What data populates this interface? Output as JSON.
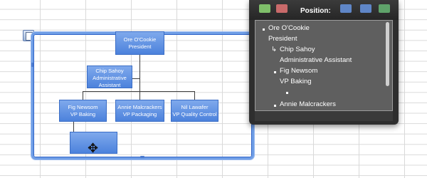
{
  "org_chart": {
    "nodes": {
      "president": {
        "name": "Ore O'Cookie",
        "title": "President"
      },
      "assistant": {
        "name": "Chip Sahoy",
        "title": "Administrative Assistant"
      },
      "baking": {
        "name": "Fig Newsom",
        "title": "VP Baking"
      },
      "packaging": {
        "name": "Annie Malcrackers",
        "title": "VP Packaging"
      },
      "quality": {
        "name": "Nil Lawafer",
        "title": "VP Quality Control"
      }
    }
  },
  "text_pane": {
    "position_label": "Position:",
    "items": [
      {
        "text": "Ore O'Cookie",
        "symbol": "▪"
      },
      {
        "text": "President",
        "symbol": ""
      },
      {
        "text": "Chip Sahoy",
        "symbol": "↳"
      },
      {
        "text": "Administrative Assistant",
        "symbol": ""
      },
      {
        "text": "Fig Newsom",
        "symbol": "▪"
      },
      {
        "text": "VP Baking",
        "symbol": ""
      },
      {
        "text": "",
        "symbol": "▪"
      },
      {
        "text": "Annie Malcrackers",
        "symbol": "▪"
      }
    ]
  },
  "colors": {
    "node_fill": "#5b8fe2",
    "pane_bg": "#5f5f5f",
    "selection_border": "#6f9ee6"
  }
}
